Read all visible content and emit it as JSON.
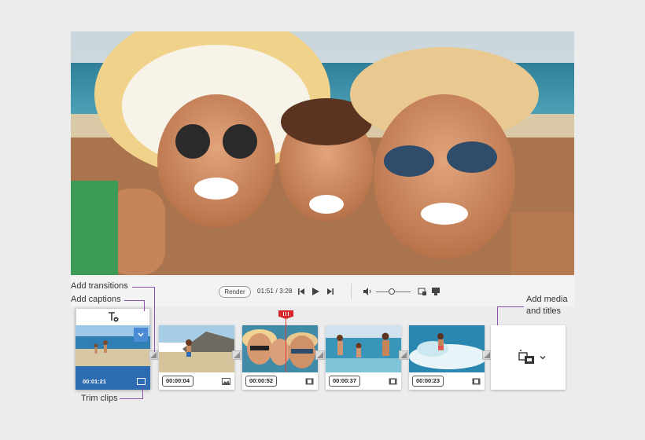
{
  "callouts": {
    "add_transitions": "Add transitions",
    "add_captions": "Add captions",
    "trim_clips": "Trim clips",
    "add_media_line1": "Add media",
    "add_media_line2": "and titles"
  },
  "toolbar": {
    "render_label": "Render",
    "timecode": "01:51 / 3:28"
  },
  "timeline": {
    "selected_clip_duration": "00:01:21",
    "clips": [
      {
        "duration": "00:00:04",
        "type": "image-icon"
      },
      {
        "duration": "00:00:52",
        "type": "film-icon"
      },
      {
        "duration": "00:00:37",
        "type": "film-icon"
      },
      {
        "duration": "00:00:23",
        "type": "film-icon"
      }
    ]
  },
  "colors": {
    "accent_blue": "#2d6cb3",
    "callout_purple": "#8e4fb0",
    "playhead_red": "#d8272d"
  }
}
